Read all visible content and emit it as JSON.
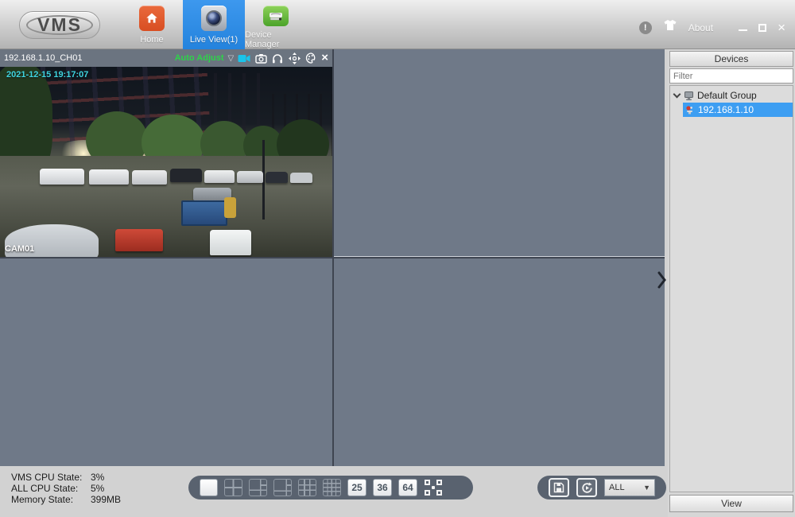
{
  "titlebar": {
    "logo": "VMS",
    "about": "About"
  },
  "tabs": [
    {
      "label": "Home"
    },
    {
      "label": "Live View(1)"
    },
    {
      "label": "Device Manager"
    }
  ],
  "video_panel": {
    "title": "192.168.1.10_CH01",
    "auto_adjust": "Auto Adjust",
    "timestamp": "2021-12-15 19:17:07",
    "camera_label": "CAM01"
  },
  "sidebar": {
    "header": "Devices",
    "filter_placeholder": "Filter",
    "group_label": "Default Group",
    "device_label": "192.168.1.10",
    "view_button": "View"
  },
  "status": [
    {
      "label": "VMS CPU State:",
      "value": "3%"
    },
    {
      "label": "ALL CPU State:",
      "value": "5%"
    },
    {
      "label": "Memory State:",
      "value": "399MB"
    }
  ],
  "layout_toolbar": {
    "btn25": "25",
    "btn36": "36",
    "btn64": "64"
  },
  "stream_toolbar": {
    "dropdown_value": "ALL"
  },
  "icons": {
    "auto_adjust_dropdown": "▽",
    "panel_close": "×",
    "close_window": "×",
    "info": "!",
    "dropdown_arrow": "▼"
  },
  "colors": {
    "active_tab": "#2b8ce8",
    "selection_blue": "#3d9ef2",
    "auto_adjust_green": "#2ed24a",
    "timestamp_cyan": "#3fd4e0",
    "grid_background": "#6f7988"
  }
}
